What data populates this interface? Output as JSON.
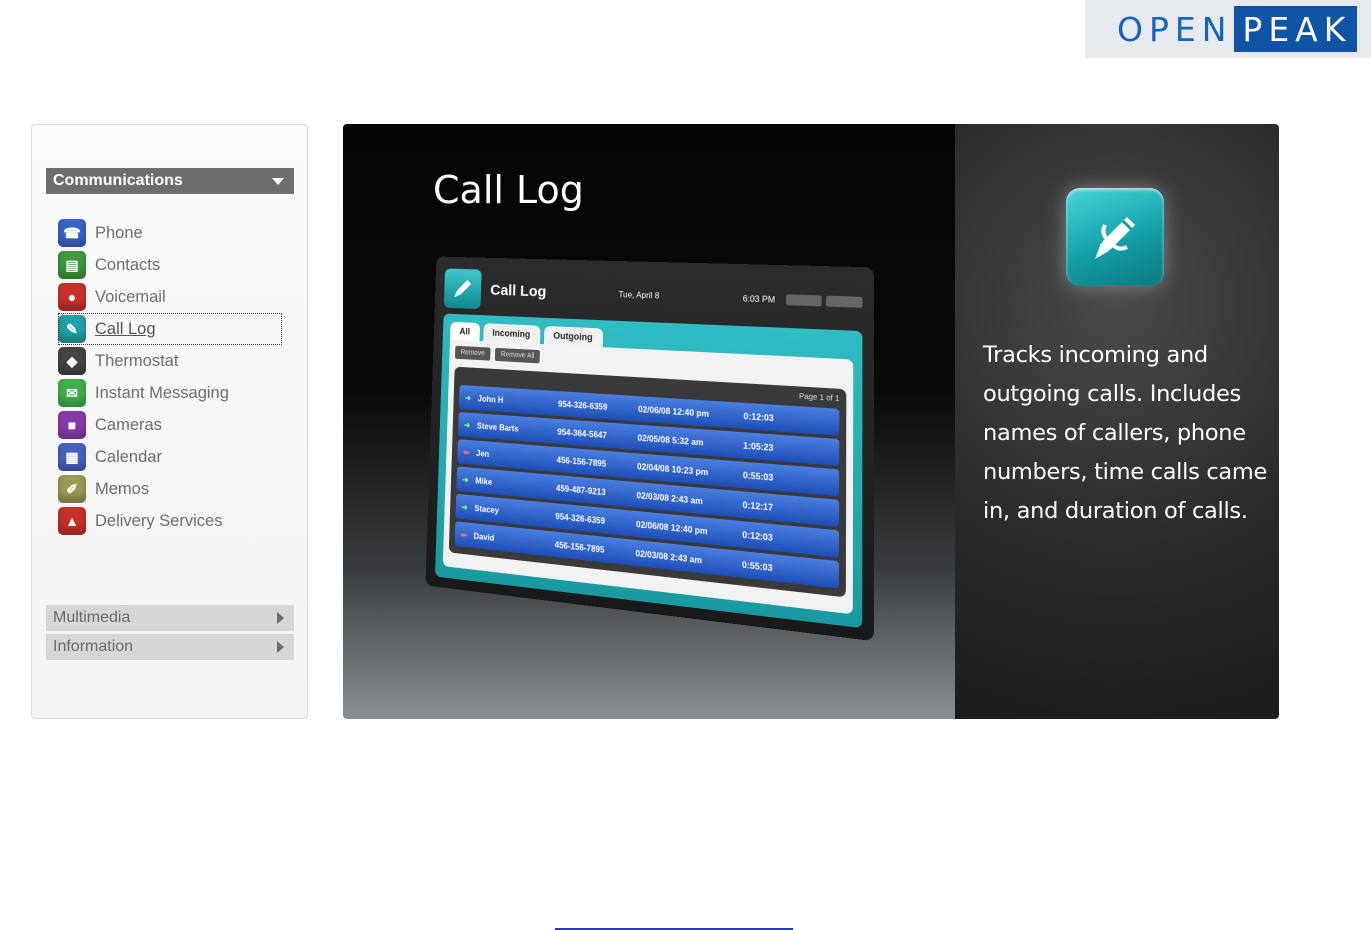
{
  "logo": {
    "open": "OPEN",
    "peak": "PEAK",
    "accent_color": "#1054a8"
  },
  "sidebar": {
    "active_section": "Communications",
    "items": [
      {
        "label": "Phone",
        "icon": "phone-icon",
        "color": "#3a63c8",
        "glyph": "☎"
      },
      {
        "label": "Contacts",
        "icon": "contacts-icon",
        "color": "#3d9a3d",
        "glyph": "▤"
      },
      {
        "label": "Voicemail",
        "icon": "voicemail-icon",
        "color": "#c9302c",
        "glyph": "●"
      },
      {
        "label": "Call Log",
        "icon": "call-log-icon",
        "color": "#1ea3a8",
        "glyph": "✎"
      },
      {
        "label": "Thermostat",
        "icon": "thermostat-icon",
        "color": "#444444",
        "glyph": "◆"
      },
      {
        "label": "Instant Messaging",
        "icon": "instant-messaging-icon",
        "color": "#3fb04a",
        "glyph": "✉"
      },
      {
        "label": "Cameras",
        "icon": "cameras-icon",
        "color": "#8a3aa8",
        "glyph": "■"
      },
      {
        "label": "Calendar",
        "icon": "calendar-icon",
        "color": "#4a5fc0",
        "glyph": "▦"
      },
      {
        "label": "Memos",
        "icon": "memos-icon",
        "color": "#9a9a55",
        "glyph": "✐"
      },
      {
        "label": "Delivery Services",
        "icon": "delivery-services-icon",
        "color": "#c8302a",
        "glyph": "▲"
      }
    ],
    "selected_item": "Call Log",
    "collapsed_sections": [
      "Multimedia",
      "Information"
    ]
  },
  "feature": {
    "title": "Call Log",
    "description": "Tracks incoming and outgoing calls. Includes names of callers, phone numbers, time calls came in, and duration of calls."
  },
  "device": {
    "title": "Call Log",
    "date": "Tue, April 8",
    "time": "6:03 PM",
    "tabs": [
      "All",
      "Incoming",
      "Outgoing"
    ],
    "actions": [
      "Remove",
      "Remove All"
    ],
    "page": "Page 1 of 1",
    "rows": [
      {
        "dir": "in",
        "name": "John H",
        "number": "954-326-6359",
        "date": "02/06/08 12:40 pm",
        "dur": "0:12:03"
      },
      {
        "dir": "in",
        "name": "Steve Barts",
        "number": "954-364-5647",
        "date": "02/05/08 5:32 am",
        "dur": "1:05:23"
      },
      {
        "dir": "out",
        "name": "Jen",
        "number": "456-156-7895",
        "date": "02/04/08 10:23 pm",
        "dur": "0:55:03"
      },
      {
        "dir": "in",
        "name": "Mike",
        "number": "459-487-9213",
        "date": "02/03/08 2:43 am",
        "dur": "0:12:17"
      },
      {
        "dir": "in",
        "name": "Stacey",
        "number": "954-326-6359",
        "date": "02/06/08 12:40 pm",
        "dur": "0:12:03"
      },
      {
        "dir": "out",
        "name": "David",
        "number": "456-156-7895",
        "date": "02/03/08 2:43 am",
        "dur": "0:55:03"
      }
    ]
  }
}
